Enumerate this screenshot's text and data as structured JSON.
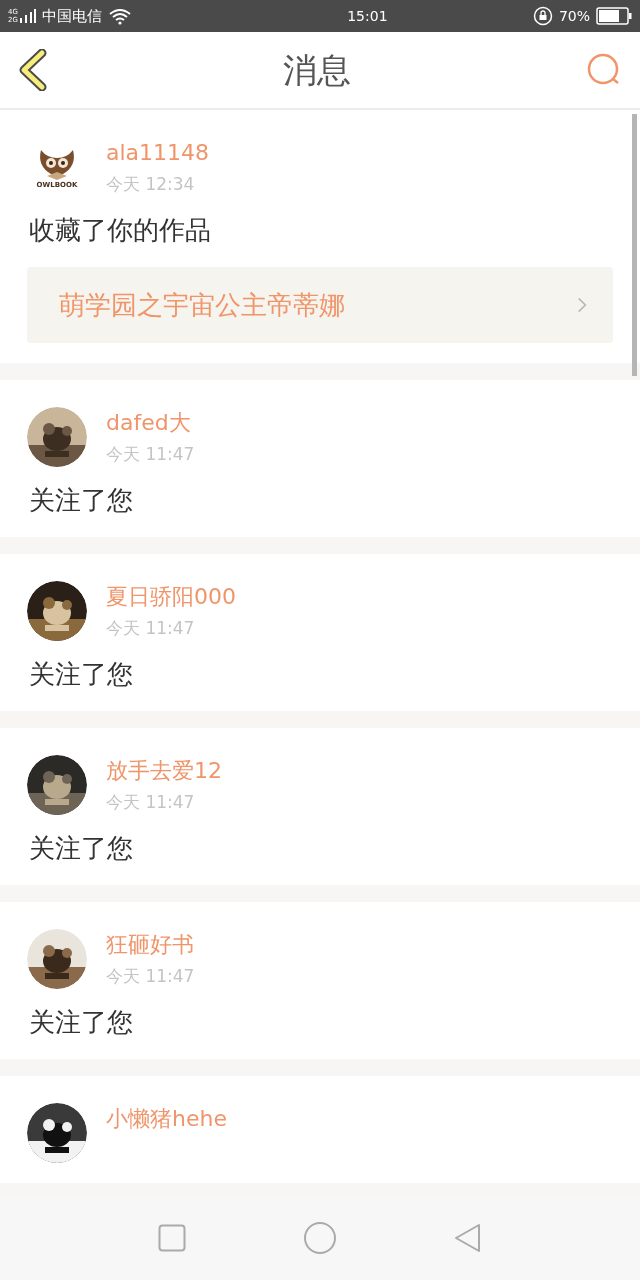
{
  "status_bar": {
    "network_labels": [
      "4G",
      "2G"
    ],
    "carrier": "中国电信",
    "time": "15:01",
    "battery_text": "70%"
  },
  "header": {
    "title": "消息"
  },
  "messages": [
    {
      "kind": "favorite",
      "avatar": {
        "kind": "logo",
        "label": "OWLBOOK"
      },
      "name": "ala11148",
      "time": "今天 12:34",
      "action": "收藏了你的作品",
      "work_title": "萌学园之宇宙公主帝蒂娜"
    },
    {
      "kind": "follow",
      "name": "dafed大",
      "time": "今天 11:47",
      "action": "关注了您"
    },
    {
      "kind": "follow",
      "name": "夏日骄阳000",
      "time": "今天 11:47",
      "action": "关注了您"
    },
    {
      "kind": "follow",
      "name": "放手去爱12",
      "time": "今天 11:47",
      "action": "关注了您"
    },
    {
      "kind": "follow",
      "name": "狂砸好书",
      "time": "今天 11:47",
      "action": "关注了您"
    },
    {
      "kind": "follow",
      "name": "小懒猪hehe"
    }
  ]
}
